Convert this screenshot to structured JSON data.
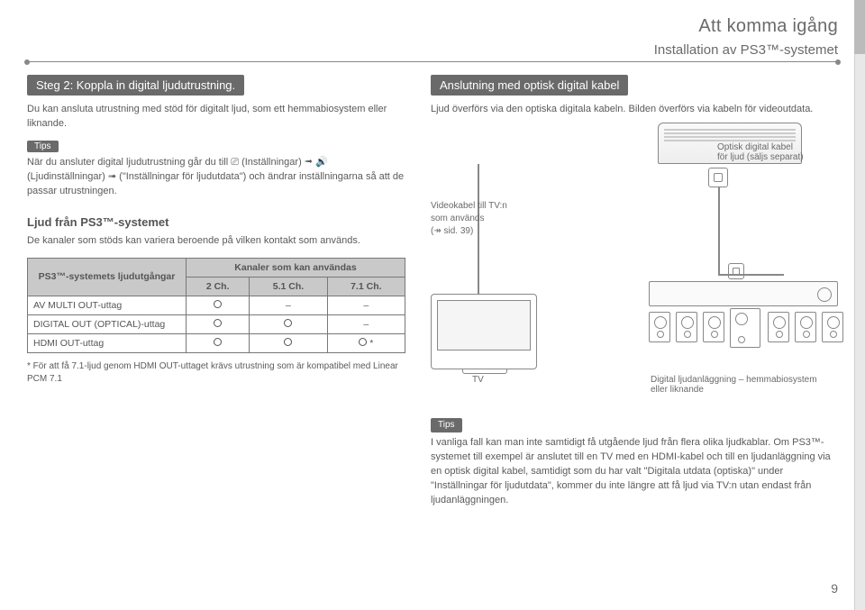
{
  "header": {
    "title1": "Att komma igång",
    "title2": "Installation av PS3™-systemet"
  },
  "left": {
    "step_heading": "Steg 2: Koppla in digital ljudutrustning.",
    "intro": "Du kan ansluta utrustning med stöd för digitalt ljud, som ett hemmabiosystem eller liknande.",
    "tips_label": "Tips",
    "tips_body": "När du ansluter digital ljudutrustning går du till ⎚ (Inställningar) ➟ 🔊 (Ljudinställningar) ➟ (\"Inställningar för ljudutdata\") och ändrar inställningarna så att de passar utrustningen.",
    "section_heading": "Ljud från PS3™-systemet",
    "section_body": "De kanaler som stöds kan variera beroende på vilken kontakt som används.",
    "table": {
      "col0_header": "PS3™-systemets ljudutgångar",
      "group_header": "Kanaler som kan användas",
      "cols": [
        "2 Ch.",
        "5.1 Ch.",
        "7.1 Ch."
      ],
      "rows": [
        {
          "name": "AV MULTI OUT-uttag",
          "c": [
            "o",
            "–",
            "–"
          ]
        },
        {
          "name": "DIGITAL OUT (OPTICAL)-uttag",
          "c": [
            "o",
            "o",
            "–"
          ]
        },
        {
          "name": "HDMI OUT-uttag",
          "c": [
            "o",
            "o",
            "o*"
          ]
        }
      ]
    },
    "footnote": "* För att få 7.1-ljud genom HDMI OUT-uttaget krävs utrustning som är kompatibel med Linear PCM 7.1"
  },
  "right": {
    "heading": "Anslutning med optisk digital kabel",
    "intro": "Ljud överförs via den optiska digitala kabeln. Bilden överförs via kabeln för videoutdata.",
    "optical_label_1": "Optisk digital kabel",
    "optical_label_2": "för ljud (säljs separat)",
    "video_label_1": "Videokabel till TV:n",
    "video_label_2": "som används",
    "video_label_3": "(↠ sid. 39)",
    "tv_label": "TV",
    "amp_label": "Digital ljudanläggning – hemmabiosystem eller liknande",
    "tips_label": "Tips",
    "tips_body": "I vanliga fall kan man inte samtidigt få utgående ljud från flera olika ljudkablar. Om PS3™-systemet till exempel är anslutet till en TV med en HDMI-kabel och till en ljudanläggning via en optisk digital kabel, samtidigt som du har valt \"Digitala utdata (optiska)\" under \"Inställningar för ljudutdata\", kommer du inte längre att få ljud via TV:n utan endast från ljudanläggningen."
  },
  "page_number": "9"
}
